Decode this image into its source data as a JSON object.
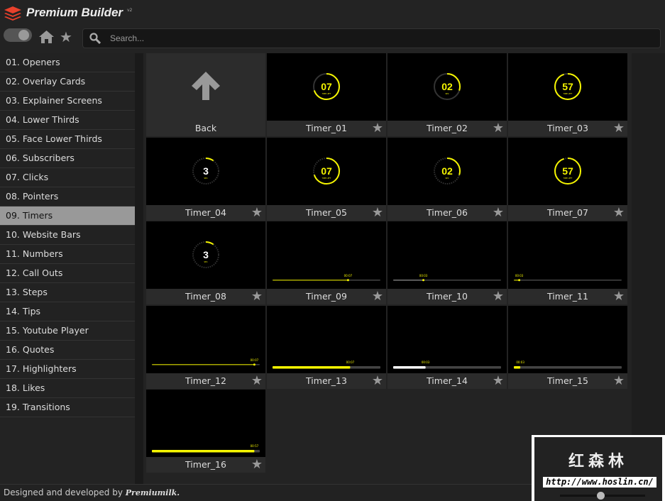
{
  "header": {
    "title": "Premium Builder",
    "version": "v2"
  },
  "toolbar": {
    "search_placeholder": "Search..."
  },
  "sidebar": {
    "items": [
      "01. Openers",
      "02. Overlay Cards",
      "03. Explainer Screens",
      "04. Lower Thirds",
      "05. Face Lower Thirds",
      "06. Subscribers",
      "07. Clicks",
      "08. Pointers",
      "09. Timers",
      "10. Website Bars",
      "11. Numbers",
      "12. Call Outs",
      "13. Steps",
      "14. Tips",
      "15. Youtube Player",
      "16. Quotes",
      "17. Highlighters",
      "18. Likes",
      "19. Transitions"
    ],
    "active": 8
  },
  "grid": {
    "back_label": "Back",
    "tiles": [
      {
        "label": "Timer_01",
        "kind": "ring",
        "value": "07",
        "sub": "TIME LEFT",
        "progress": 0.7,
        "dashed": false
      },
      {
        "label": "Timer_02",
        "kind": "ring",
        "value": "02",
        "sub": "SEC",
        "progress": 0.3,
        "dashed": false
      },
      {
        "label": "Timer_03",
        "kind": "ring",
        "value": "57",
        "sub": "TIME LEFT",
        "progress": 0.95,
        "dashed": false
      },
      {
        "label": "Timer_04",
        "kind": "ring-white",
        "value": "3",
        "sub": "SEC",
        "progress": 0.1,
        "dashed": true
      },
      {
        "label": "Timer_05",
        "kind": "ring",
        "value": "07",
        "sub": "TIME LEFT",
        "progress": 0.7,
        "dashed": true
      },
      {
        "label": "Timer_06",
        "kind": "ring",
        "value": "02",
        "sub": "SEC",
        "progress": 0.3,
        "dashed": true
      },
      {
        "label": "Timer_07",
        "kind": "ring",
        "value": "57",
        "sub": "TIME LEFT",
        "progress": 0.95,
        "dashed": true
      },
      {
        "label": "Timer_08",
        "kind": "ring-white",
        "value": "3",
        "sub": "SEC",
        "progress": 0.1,
        "dashed": true
      },
      {
        "label": "Timer_09",
        "kind": "line",
        "value": "00:07",
        "progress": 0.7,
        "color": "#a8a800"
      },
      {
        "label": "Timer_10",
        "kind": "line",
        "value": "00:03",
        "progress": 0.28,
        "color": "#777777"
      },
      {
        "label": "Timer_11",
        "kind": "line",
        "value": "00:03",
        "progress": 0.05,
        "color": "#a8a800"
      },
      {
        "label": "Timer_12",
        "kind": "line",
        "value": "00:07",
        "progress": 0.95,
        "color": "#a8a800"
      },
      {
        "label": "Timer_13",
        "kind": "bar",
        "value": "00:07",
        "progress": 0.72,
        "color": "#f5f500"
      },
      {
        "label": "Timer_14",
        "kind": "bar",
        "value": "00:03",
        "progress": 0.3,
        "color": "#ffffff"
      },
      {
        "label": "Timer_15",
        "kind": "bar",
        "value": "00:03",
        "progress": 0.06,
        "color": "#f5f500"
      },
      {
        "label": "Timer_16",
        "kind": "bar",
        "value": "00:57",
        "progress": 0.95,
        "color": "#f5f500"
      }
    ]
  },
  "footer": {
    "text": "Designed and developed by",
    "brand": "Premiumilk."
  },
  "watermark": {
    "cn": "红森林",
    "url": "http://www.hoslin.cn/"
  },
  "colors": {
    "accent": "#f5f500",
    "logo": "#e8412c",
    "active": "#999999"
  }
}
